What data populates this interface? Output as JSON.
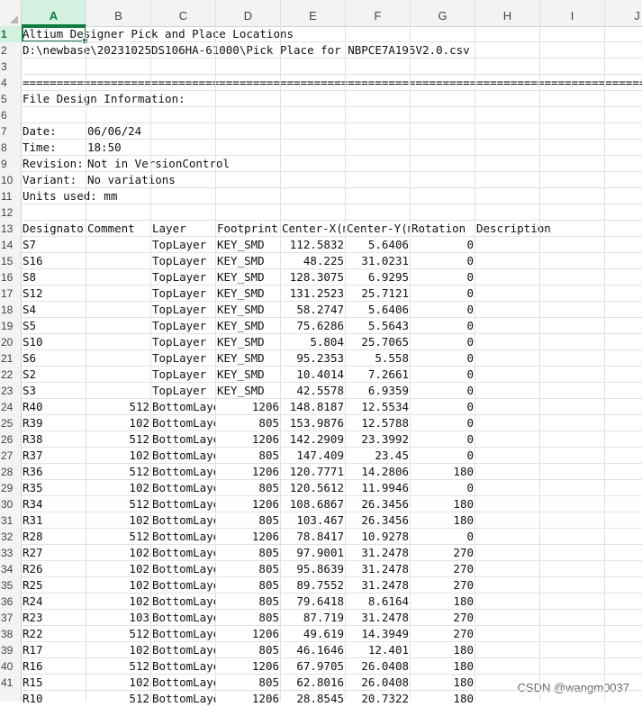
{
  "columns": [
    "A",
    "B",
    "C",
    "D",
    "E",
    "F",
    "G",
    "H",
    "I",
    "J"
  ],
  "selected_column": "A",
  "selected_row": 1,
  "header_lines": {
    "title": "Altium Designer Pick and Place Locations",
    "path": "D:\\newbase\\20231025DS106HA-61000\\Pick Place for NBPCE7A195V2.0.csv",
    "separator": "================================================================================================================================================",
    "file_design_info": "File Design Information:",
    "date_label": "Date:",
    "date_value": "06/06/24",
    "time_label": "Time:",
    "time_value": "18:50",
    "revision_label": "Revision:",
    "revision_value": "Not in VersionControl",
    "variant_label": "Variant:",
    "variant_value": "No variations",
    "units_label": "Units used: mm"
  },
  "table_headers": [
    "Designator",
    "Comment",
    "Layer",
    "Footprint",
    "Center-X(mm)",
    "Center-Y(mm)",
    "Rotation",
    "Description"
  ],
  "rows": [
    [
      "S7",
      "",
      "TopLayer",
      "KEY_SMD",
      "112.5832",
      "5.6406",
      "0"
    ],
    [
      "S16",
      "",
      "TopLayer",
      "KEY_SMD",
      "48.225",
      "31.0231",
      "0"
    ],
    [
      "S8",
      "",
      "TopLayer",
      "KEY_SMD",
      "128.3075",
      "6.9295",
      "0"
    ],
    [
      "S12",
      "",
      "TopLayer",
      "KEY_SMD",
      "131.2523",
      "25.7121",
      "0"
    ],
    [
      "S4",
      "",
      "TopLayer",
      "KEY_SMD",
      "58.2747",
      "5.6406",
      "0"
    ],
    [
      "S5",
      "",
      "TopLayer",
      "KEY_SMD",
      "75.6286",
      "5.5643",
      "0"
    ],
    [
      "S10",
      "",
      "TopLayer",
      "KEY_SMD",
      "5.804",
      "25.7065",
      "0"
    ],
    [
      "S6",
      "",
      "TopLayer",
      "KEY_SMD",
      "95.2353",
      "5.558",
      "0"
    ],
    [
      "S2",
      "",
      "TopLayer",
      "KEY_SMD",
      "10.4014",
      "7.2661",
      "0"
    ],
    [
      "S3",
      "",
      "TopLayer",
      "KEY_SMD",
      "42.5578",
      "6.9359",
      "0"
    ],
    [
      "R40",
      "512",
      "BottomLayer",
      "1206",
      "148.8187",
      "12.5534",
      "0"
    ],
    [
      "R39",
      "102",
      "BottomLayer",
      "805",
      "153.9876",
      "12.5788",
      "0"
    ],
    [
      "R38",
      "512",
      "BottomLayer",
      "1206",
      "142.2909",
      "23.3992",
      "0"
    ],
    [
      "R37",
      "102",
      "BottomLayer",
      "805",
      "147.409",
      "23.45",
      "0"
    ],
    [
      "R36",
      "512",
      "BottomLayer",
      "1206",
      "120.7771",
      "14.2806",
      "180"
    ],
    [
      "R35",
      "102",
      "BottomLayer",
      "805",
      "120.5612",
      "11.9946",
      "0"
    ],
    [
      "R34",
      "512",
      "BottomLayer",
      "1206",
      "108.6867",
      "26.3456",
      "180"
    ],
    [
      "R31",
      "102",
      "BottomLayer",
      "805",
      "103.467",
      "26.3456",
      "180"
    ],
    [
      "R28",
      "512",
      "BottomLayer",
      "1206",
      "78.8417",
      "10.9278",
      "0"
    ],
    [
      "R27",
      "102",
      "BottomLayer",
      "805",
      "97.9001",
      "31.2478",
      "270"
    ],
    [
      "R26",
      "102",
      "BottomLayer",
      "805",
      "95.8639",
      "31.2478",
      "270"
    ],
    [
      "R25",
      "102",
      "BottomLayer",
      "805",
      "89.7552",
      "31.2478",
      "270"
    ],
    [
      "R24",
      "102",
      "BottomLayer",
      "805",
      "79.6418",
      "8.6164",
      "180"
    ],
    [
      "R23",
      "103",
      "BottomLayer",
      "805",
      "87.719",
      "31.2478",
      "270"
    ],
    [
      "R22",
      "512",
      "BottomLayer",
      "1206",
      "49.619",
      "14.3949",
      "270"
    ],
    [
      "R17",
      "102",
      "BottomLayer",
      "805",
      "46.1646",
      "12.401",
      "180"
    ],
    [
      "R16",
      "512",
      "BottomLayer",
      "1206",
      "67.9705",
      "26.0408",
      "180"
    ],
    [
      "R15",
      "102",
      "BottomLayer",
      "805",
      "62.8016",
      "26.0408",
      "180"
    ],
    [
      "R10",
      "512",
      "BottomLayer",
      "1206",
      "28.8545",
      "20.7322",
      "180"
    ]
  ],
  "watermark": "CSDN @wangm0037"
}
